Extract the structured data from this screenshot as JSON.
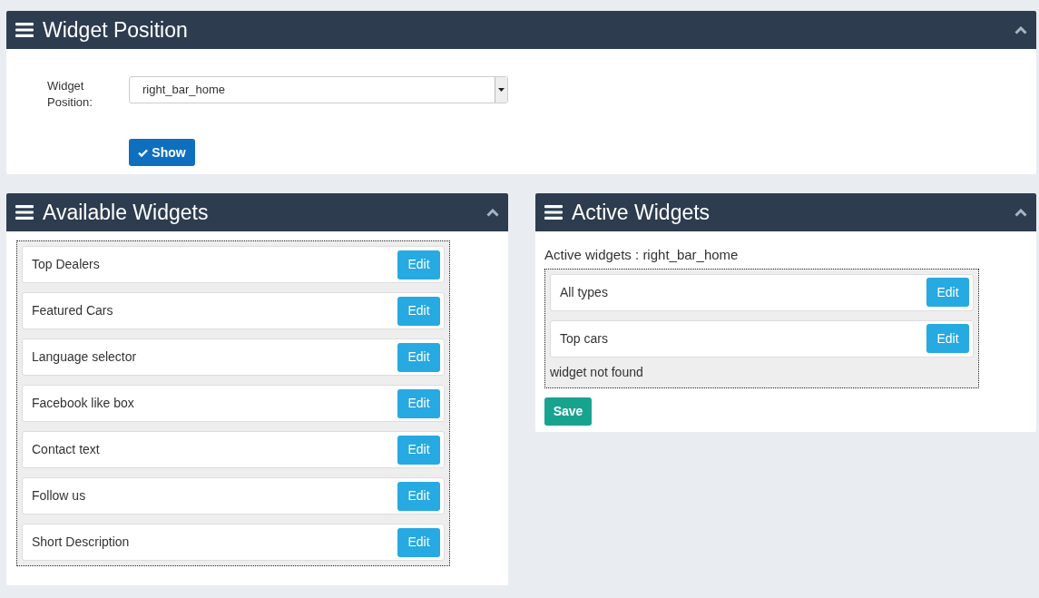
{
  "position_panel": {
    "title": "Widget Position",
    "field_label": "Widget Position:",
    "select_value": "right_bar_home",
    "show_button": "Show"
  },
  "available_panel": {
    "title": "Available Widgets",
    "widgets": [
      {
        "name": "Top Dealers",
        "button": "Edit"
      },
      {
        "name": "Featured Cars",
        "button": "Edit"
      },
      {
        "name": "Language selector",
        "button": "Edit"
      },
      {
        "name": "Facebook like box",
        "button": "Edit"
      },
      {
        "name": "Contact text",
        "button": "Edit"
      },
      {
        "name": "Follow us",
        "button": "Edit"
      },
      {
        "name": "Short Description",
        "button": "Edit"
      }
    ]
  },
  "active_panel": {
    "title": "Active Widgets",
    "heading": "Active widgets : right_bar_home",
    "widgets": [
      {
        "name": "All types",
        "button": "Edit"
      },
      {
        "name": "Top cars",
        "button": "Edit"
      }
    ],
    "note": "widget not found",
    "save_button": "Save"
  }
}
